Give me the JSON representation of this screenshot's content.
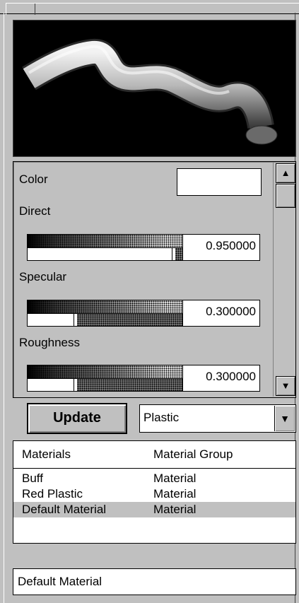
{
  "properties": {
    "color_label": "Color",
    "direct": {
      "label": "Direct",
      "value": "0.950000",
      "level": 0.95
    },
    "specular": {
      "label": "Specular",
      "value": "0.300000",
      "level": 0.3
    },
    "roughness": {
      "label": "Roughness",
      "value": "0.300000",
      "level": 0.3
    }
  },
  "scrollbar": {
    "up_icon": "arrow-up-icon",
    "down_icon": "arrow-down-icon"
  },
  "update_label": "Update",
  "material_type": {
    "selected": "Plastic"
  },
  "materials": {
    "headers": [
      "Materials",
      "Material Group"
    ],
    "rows": [
      {
        "name": "Buff",
        "group": "Material"
      },
      {
        "name": "Red Plastic",
        "group": "Material"
      },
      {
        "name": "Default Material",
        "group": "Material"
      }
    ],
    "selected_index": 2
  },
  "status_text": "Default Material"
}
